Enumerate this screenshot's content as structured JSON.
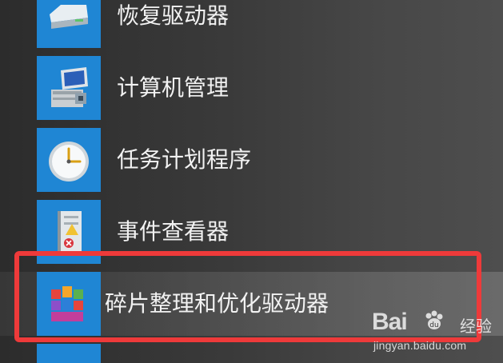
{
  "menu": {
    "items": [
      {
        "label": "恢复驱动器",
        "icon": "drive-icon",
        "selected": false
      },
      {
        "label": "计算机管理",
        "icon": "computer-management-icon",
        "selected": false
      },
      {
        "label": "任务计划程序",
        "icon": "clock-icon",
        "selected": false
      },
      {
        "label": "事件查看器",
        "icon": "event-log-icon",
        "selected": false
      },
      {
        "label": "碎片整理和优化驱动器",
        "icon": "defrag-icon",
        "selected": true
      }
    ]
  },
  "watermark": {
    "brand_left": "Bai",
    "brand_right": "经验",
    "domain": "jingyan.baidu.com"
  },
  "colors": {
    "tile": "#1f86d4",
    "highlight": "#ee3a3a",
    "text": "#f2f2f2"
  }
}
